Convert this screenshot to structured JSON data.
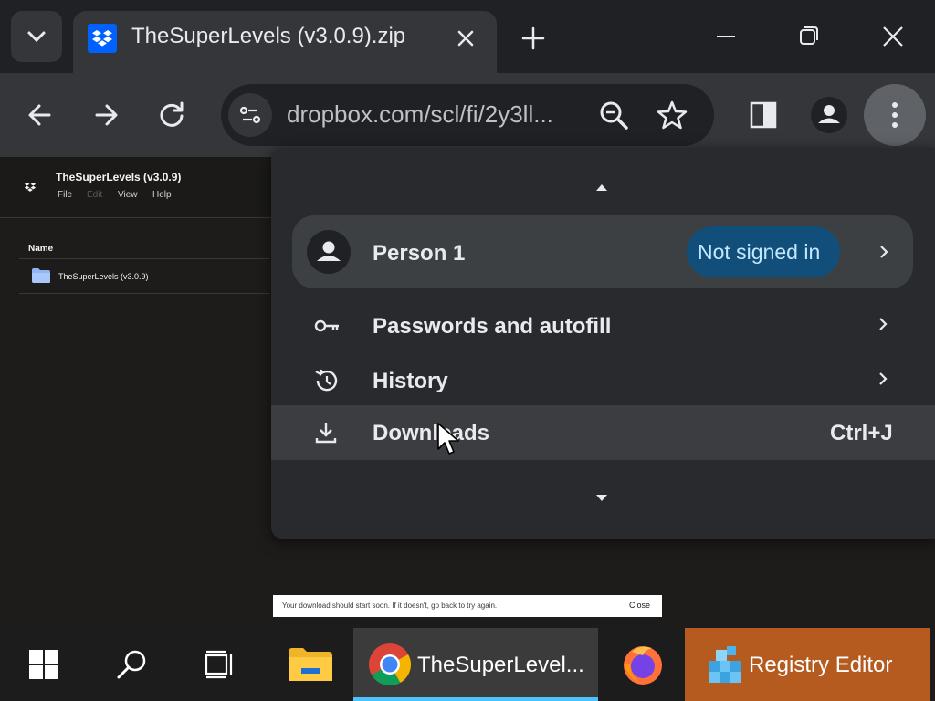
{
  "tab": {
    "title": "TheSuperLevels (v3.0.9).zip"
  },
  "omnibox": {
    "url": "dropbox.com/scl/fi/2y3ll..."
  },
  "page": {
    "title": "TheSuperLevels (v3.0.9)",
    "menu": [
      "File",
      "Edit",
      "View",
      "Help"
    ],
    "column_header": "Name",
    "rows": [
      {
        "name": "TheSuperLevels (v3.0.9)"
      }
    ]
  },
  "banner": {
    "text": "Your download should start soon. If it doesn't, go back to try again.",
    "close": "Close"
  },
  "menu": {
    "person": {
      "name": "Person 1",
      "status": "Not signed in"
    },
    "items": [
      {
        "label": "Passwords and autofill",
        "icon": "key-icon"
      },
      {
        "label": "History",
        "icon": "history-icon"
      },
      {
        "label": "Downloads",
        "icon": "download-icon",
        "shortcut": "Ctrl+J"
      }
    ]
  },
  "taskbar": {
    "chrome_label": "TheSuperLevel...",
    "regedit_label": "Registry Editor"
  },
  "colors": {
    "accent_blue": "#4cc2ff",
    "signin_pill": "#114e79",
    "regedit_highlight": "#b55b20",
    "dropbox_blue": "#0061fe"
  }
}
